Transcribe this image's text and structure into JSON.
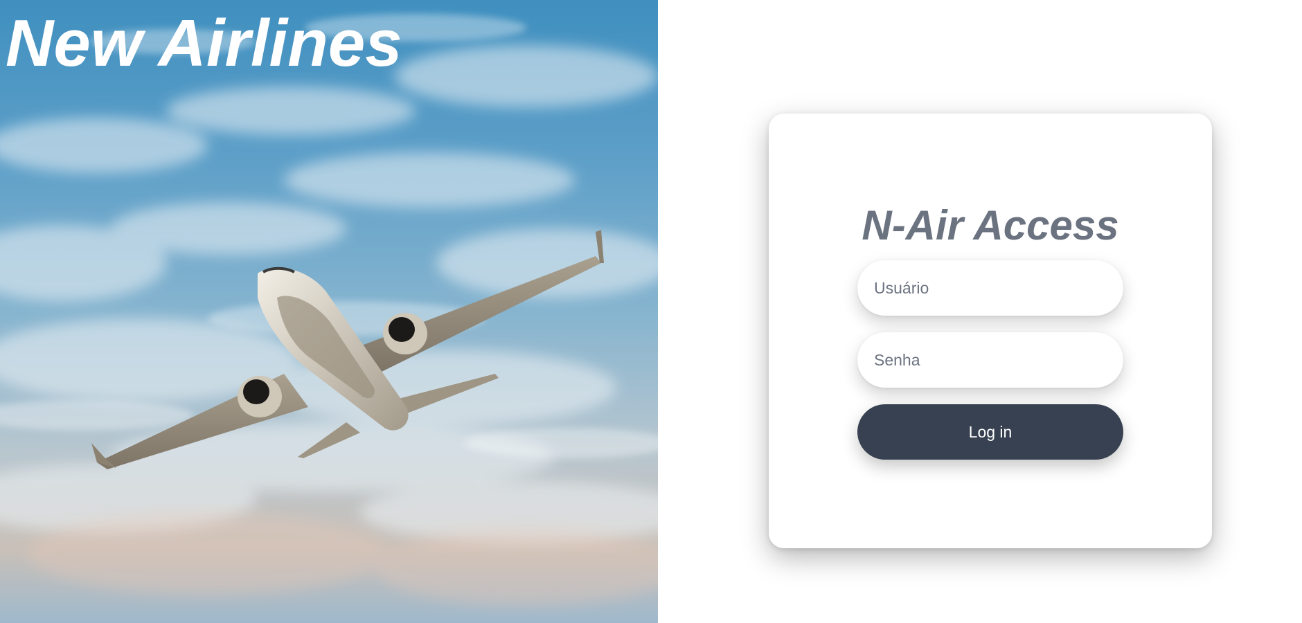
{
  "hero": {
    "brand_title": "New Airlines",
    "image_icon": "airplane-photo",
    "colors": {
      "sky_top": "#3f8fbf",
      "sky_bottom": "#c9c0b8"
    }
  },
  "login": {
    "title": "N-Air Access",
    "username_placeholder": "Usuário",
    "password_placeholder": "Senha",
    "submit_label": "Log in",
    "colors": {
      "title": "#6b7280",
      "button": "#374151",
      "button_text": "#ffffff"
    }
  }
}
